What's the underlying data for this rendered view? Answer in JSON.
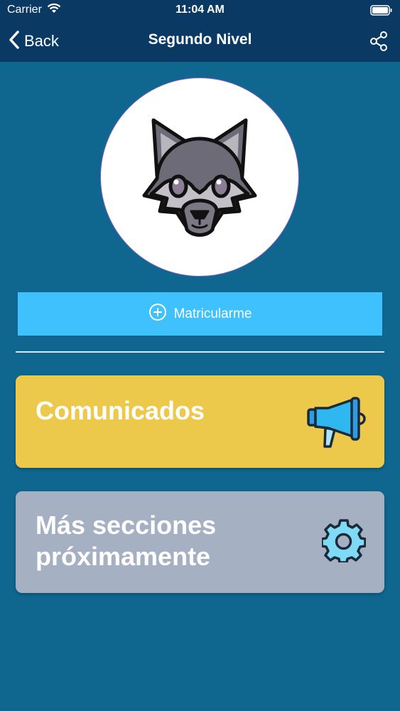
{
  "status_bar": {
    "carrier": "Carrier",
    "time": "11:04 AM"
  },
  "nav": {
    "back_label": "Back",
    "title": "Segundo Nivel"
  },
  "avatar": {
    "icon": "wolf-icon"
  },
  "enroll_button": {
    "label": "Matricularme",
    "icon": "plus-circle-icon",
    "color": "#3ec1fd"
  },
  "cards": [
    {
      "title": "Comunicados",
      "icon": "megaphone-icon",
      "color": "#ecc84b"
    },
    {
      "title_line1": "Más secciones",
      "title_line2": "próximamente",
      "icon": "gear-icon",
      "color": "#a5b0c2"
    }
  ],
  "colors": {
    "background": "#0f6790",
    "navbar": "#0a3a63"
  }
}
